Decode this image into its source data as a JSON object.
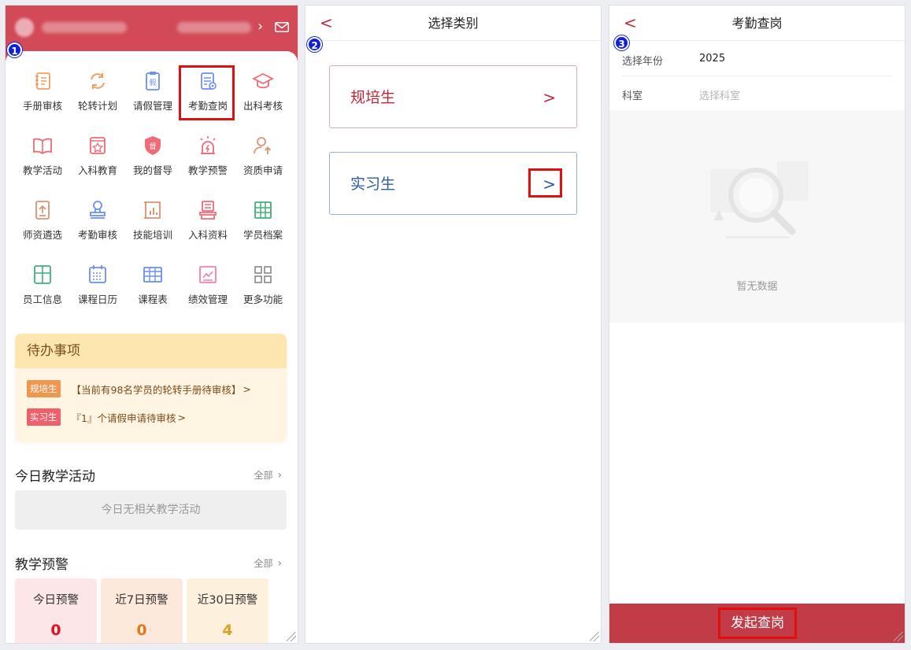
{
  "panel1": {
    "step": "1",
    "grid": [
      {
        "label": "手册审核",
        "icon": "handbook-icon"
      },
      {
        "label": "轮转计划",
        "icon": "rotation-icon"
      },
      {
        "label": "请假管理",
        "icon": "leave-icon"
      },
      {
        "label": "考勤查岗",
        "icon": "attendance-check-icon"
      },
      {
        "label": "出科考核",
        "icon": "graduation-cap-icon"
      },
      {
        "label": "教学活动",
        "icon": "open-book-icon"
      },
      {
        "label": "入科教育",
        "icon": "admission-education-icon"
      },
      {
        "label": "我的督导",
        "icon": "supervision-shield-icon"
      },
      {
        "label": "教学预警",
        "icon": "alarm-icon"
      },
      {
        "label": "资质申请",
        "icon": "user-upload-icon"
      },
      {
        "label": "师资遴选",
        "icon": "upload-doc-icon"
      },
      {
        "label": "考勤审核",
        "icon": "stamp-icon"
      },
      {
        "label": "技能培训",
        "icon": "skill-chart-icon"
      },
      {
        "label": "入科资料",
        "icon": "stack-docs-icon"
      },
      {
        "label": "学员档案",
        "icon": "archive-grid-icon"
      },
      {
        "label": "员工信息",
        "icon": "staff-info-icon"
      },
      {
        "label": "课程日历",
        "icon": "calendar-icon"
      },
      {
        "label": "课程表",
        "icon": "timetable-icon"
      },
      {
        "label": "绩效管理",
        "icon": "performance-chart-icon"
      },
      {
        "label": "更多功能",
        "icon": "more-grid-icon"
      }
    ],
    "todo": {
      "title": "待办事项",
      "items": [
        {
          "tag": "规培生",
          "text": "【当前有98名学员的轮转手册待审核】",
          "arrow": ">"
        },
        {
          "tag": "实习生",
          "text": "『1』个请假申请待审核",
          "arrow": ">"
        }
      ]
    },
    "today": {
      "title": "今日教学活动",
      "more": "全部",
      "empty": "今日无相关教学活动"
    },
    "warning": {
      "title": "教学预警",
      "more": "全部",
      "cards": [
        {
          "label": "今日预警",
          "value": "0",
          "bg": "#fde6e8",
          "color": "#e0141e"
        },
        {
          "label": "近7日预警",
          "value": "0",
          "bg": "#fde8dc",
          "color": "#e07b18"
        },
        {
          "label": "近30日预警",
          "value": "4",
          "bg": "#fdf0dc",
          "color": "#d7a228"
        }
      ]
    }
  },
  "panel2": {
    "step": "2",
    "title": "选择类别",
    "back": "<",
    "categories": [
      {
        "label": "规培生",
        "arrow": ">"
      },
      {
        "label": "实习生",
        "arrow": ">"
      }
    ]
  },
  "panel3": {
    "step": "3",
    "title": "考勤查岗",
    "back": "<",
    "year_label": "选择年份",
    "year_value": "2025",
    "dept_label": "科室",
    "dept_placeholder": "选择科室",
    "empty": "暂无数据",
    "submit": "发起查岗"
  },
  "colors": {
    "header_red": "#d24a57",
    "accent_red": "#c0283a",
    "highlight": "#e01010",
    "badge_blue": "#1020d8"
  }
}
